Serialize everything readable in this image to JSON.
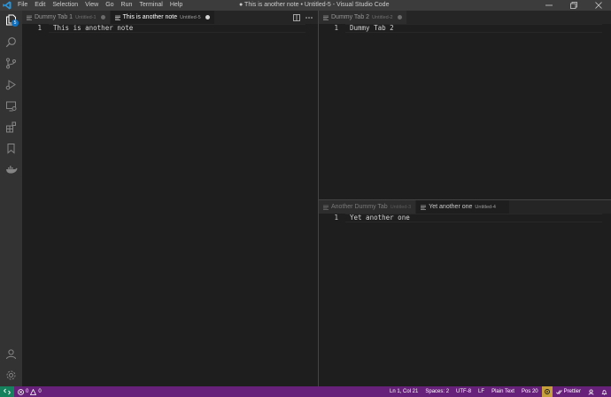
{
  "titlebar": {
    "menu": [
      "File",
      "Edit",
      "Selection",
      "View",
      "Go",
      "Run",
      "Terminal",
      "Help"
    ],
    "window_title": "● This is another note • Untitled-5 - Visual Studio Code"
  },
  "activitybar": {
    "explorer_badge": "5"
  },
  "group_left": {
    "tabs": [
      {
        "label": "Dummy Tab 1",
        "desc": "Untitled-1"
      },
      {
        "label": "This is another note",
        "desc": "Untitled-5"
      }
    ],
    "line_number": "1",
    "line_text": "This is another note"
  },
  "group_top_right": {
    "tabs": [
      {
        "label": "Dummy Tab 2",
        "desc": "Untitled-2"
      }
    ],
    "line_number": "1",
    "line_text": "Dummy Tab 2"
  },
  "group_bottom_right": {
    "tabs": [
      {
        "label": "Another Dummy Tab",
        "desc": "Untitled-3"
      },
      {
        "label": "Yet another one",
        "desc": "Untitled-4"
      }
    ],
    "line_number": "1",
    "line_text": "Yet another one"
  },
  "statusbar": {
    "errors": "0",
    "warnings": "0",
    "position": "Ln 1, Col 21",
    "spaces": "Spaces: 2",
    "encoding": "UTF-8",
    "eol": "LF",
    "language": "Plain Text",
    "pos": "Pos 20",
    "prettier": "Prettier"
  },
  "colors": {
    "statusbar": "#68217a",
    "remote": "#16825d",
    "accent": "#007acc",
    "badge": "#0e70c0"
  }
}
